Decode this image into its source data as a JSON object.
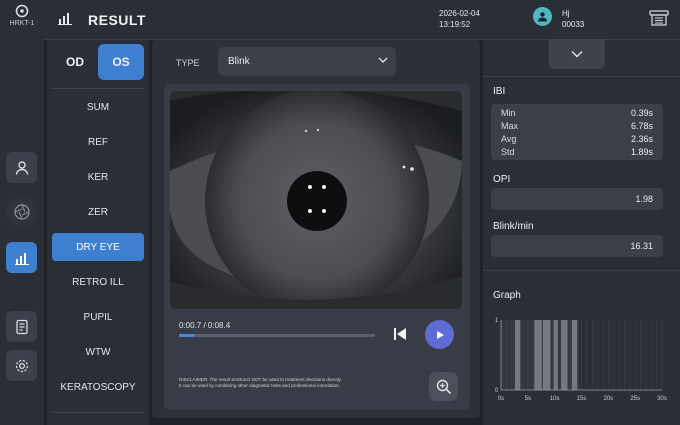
{
  "device": {
    "label": "HRKT-1"
  },
  "header": {
    "title": "RESULT",
    "date": "2026-02-04",
    "time": "13:19:52",
    "user_name": "Hj",
    "user_id": "00033"
  },
  "eye_toggle": {
    "od_label": "OD",
    "os_label": "OS",
    "selected": "OS"
  },
  "menu": {
    "items": [
      {
        "label": "SUM"
      },
      {
        "label": "REF"
      },
      {
        "label": "KER"
      },
      {
        "label": "ZER"
      },
      {
        "label": "DRY EYE",
        "active": true
      },
      {
        "label": "RETRO ILL"
      },
      {
        "label": "PUPIL"
      },
      {
        "label": "WTW"
      },
      {
        "label": "KERATOSCOPY"
      }
    ]
  },
  "viewer": {
    "type_label": "TYPE",
    "type_value": "Blink",
    "time_label": "0:00.7 / 0:08.4",
    "progress_fraction": 0.083,
    "disclaimer_line1": "DISCLAIMER: The result SHOULD NOT be used to treatment decisions directly.",
    "disclaimer_line2": "It can be used by combining other diagnostic tests and professional correlation."
  },
  "ibi": {
    "title": "IBI",
    "rows": [
      {
        "k": "Min",
        "v": "0.39s"
      },
      {
        "k": "Max",
        "v": "6.78s"
      },
      {
        "k": "Avg",
        "v": "2.36s"
      },
      {
        "k": "Std",
        "v": "1.89s"
      }
    ]
  },
  "opi": {
    "title": "OPI",
    "value": "1.98"
  },
  "blink": {
    "title": "Blink/min",
    "value": "16.31"
  },
  "graph": {
    "title": "Graph",
    "y_ticks": [
      "0",
      "1"
    ],
    "x_ticks": [
      "0s",
      "5s",
      "10s",
      "15s",
      "20s",
      "25s",
      "30s"
    ],
    "x_max": 30,
    "blink_intervals": [
      [
        2.6,
        3.6
      ],
      [
        6.2,
        7.6
      ],
      [
        7.8,
        9.2
      ],
      [
        9.8,
        10.6
      ],
      [
        11.2,
        12.4
      ],
      [
        13.2,
        14.2
      ]
    ],
    "region_end": 14.6
  },
  "colors": {
    "accent": "#3f7fd0",
    "play": "#5e6bd4",
    "avatar": "#4fb6c3"
  }
}
